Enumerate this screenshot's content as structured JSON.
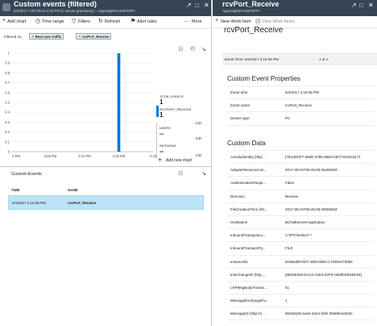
{
  "left_panel": {
    "title": "Custom events (filtered)",
    "subtitle": "5/4/2017 2:00 PM to 2:20 PM (1 minute granularity) – AppInsightFromBTIIPPI",
    "toolbar": {
      "add_chart": "Add chart",
      "time_range": "Time range",
      "filters": "Filters",
      "refresh": "Refresh",
      "alert_rules": "Alert rules",
      "more": "More"
    },
    "filtered_on_label": "Filtered on",
    "filters": [
      "Real user traffic",
      "rcvPort_Receive"
    ],
    "summary": {
      "total_events_label": "TOTAL EVENTS",
      "total_events_value": "1",
      "rcvport_label": "RCVPORT_RECEIVE",
      "rcvport_value": "1",
      "users_label": "USERS",
      "users_value": "--",
      "sessions_label": "SESSIONS",
      "sessions_value": "--",
      "edit_label": "Edit",
      "add_new_chart": "Add new chart"
    },
    "custom_events": {
      "heading": "Custom Events",
      "columns": [
        "TIME",
        "NAME"
      ],
      "rows": [
        {
          "time": "5/4/2017 2:15:05 PM",
          "name": "rcvPort_Receive"
        }
      ]
    }
  },
  "chart_data": {
    "type": "bar",
    "title": "",
    "xlabel": "",
    "ylabel": "",
    "x_tick_labels": [
      "2 PM",
      "2:05 PM",
      "2:10 PM",
      "2:15 PM",
      "2:20"
    ],
    "y_tick_labels": [
      "1",
      "0.9",
      "0.8",
      "0.7",
      "0.6",
      "0.5",
      "0.4",
      "0.3",
      "0.2",
      "0.1",
      "0"
    ],
    "ylim": [
      0,
      1
    ],
    "categories": [
      "2:15 PM"
    ],
    "values": [
      1
    ],
    "grid": true
  },
  "right_panel": {
    "title": "rcvPort_Receive",
    "subtitle": "AppInsightFromBTIIPPI",
    "toolbar": {
      "new_work_item": "New Work Item",
      "view_work_items": "View Work Items"
    },
    "event_time_label": "Event Time: 5/4/2017 2:15:05 PM",
    "pager": "1 of 1",
    "properties_heading": "Custom Event Properties",
    "properties": [
      {
        "key": "Event time",
        "value": "5/4/2017 2:15:05 PM"
      },
      {
        "key": "Event name",
        "value": "rcvPort_Receive"
      },
      {
        "key": "Device type",
        "value": "PC"
      }
    ],
    "custom_data_heading": "Custom Data",
    "custom_data": [
      {
        "key": "ActivityIdentity (http...",
        "value": "{7E34D0F7-368D-4780-92E5-5677A516C817}"
      },
      {
        "key": "AdapterReceiveCom...",
        "value": "2017-05-04T08:45:05.0840000Z"
      },
      {
        "key": "AuthenticationRequi...",
        "value": "False"
      },
      {
        "key": "Direction",
        "value": "Receive"
      },
      {
        "key": "FileCreationTime (htt...",
        "value": "2017-05-04T08:45:05.0000000Z"
      },
      {
        "key": "HostName",
        "value": "BizTalkServerApplication"
      },
      {
        "key": "InboundTransportLo...",
        "value": "C:\\FFI\\Test\\In\\*.*"
      },
      {
        "key": "InboundTransportTy...",
        "value": "FILE"
      },
      {
        "key": "InstanceID",
        "value": "8e36ad9f-0f27-4d83-9b84-176302e783b6"
      },
      {
        "key": "InterchangeID (http_...",
        "value": "{6B40E820-EAA2-42E2-82FE-0568FEEEB034}"
      },
      {
        "key": "LRPMsgBodyTrackin...",
        "value": "51"
      },
      {
        "key": "MessageExchangePa...",
        "value": "1"
      },
      {
        "key": "MessageID (http://s...",
        "value": "6b40eb20-eaa2-42e2-82fe-0568feeeb034"
      }
    ]
  }
}
